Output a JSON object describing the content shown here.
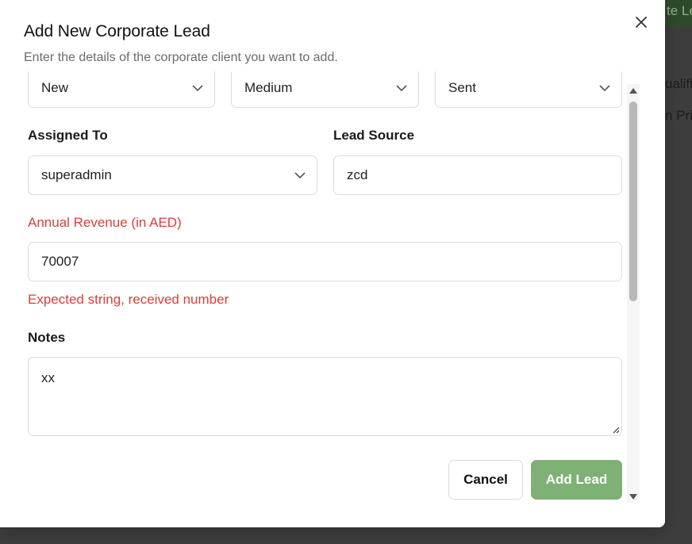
{
  "background": {
    "button_fragment": "te Le",
    "text_fragment_1": "ualifi",
    "text_fragment_2": "n Pric"
  },
  "dialog": {
    "title": "Add New Corporate Lead",
    "subtitle": "Enter the details of the corporate client you want to add."
  },
  "form": {
    "status": {
      "value": "New"
    },
    "priority": {
      "value": "Medium"
    },
    "proposal": {
      "value": "Sent"
    },
    "assigned_to": {
      "label": "Assigned To",
      "value": "superadmin"
    },
    "lead_source": {
      "label": "Lead Source",
      "value": "zcd"
    },
    "annual_revenue": {
      "label": "Annual Revenue (in AED)",
      "value": "70007",
      "error": "Expected string, received number"
    },
    "notes": {
      "label": "Notes",
      "value": "xx"
    }
  },
  "actions": {
    "cancel_label": "Cancel",
    "add_label": "Add Lead"
  },
  "colors": {
    "error": "#d9403a",
    "primary_button": "#7fb075",
    "overlay": "#3d3d3d"
  },
  "icons": {
    "close": "close-icon",
    "select": "chevron-down-icon"
  }
}
